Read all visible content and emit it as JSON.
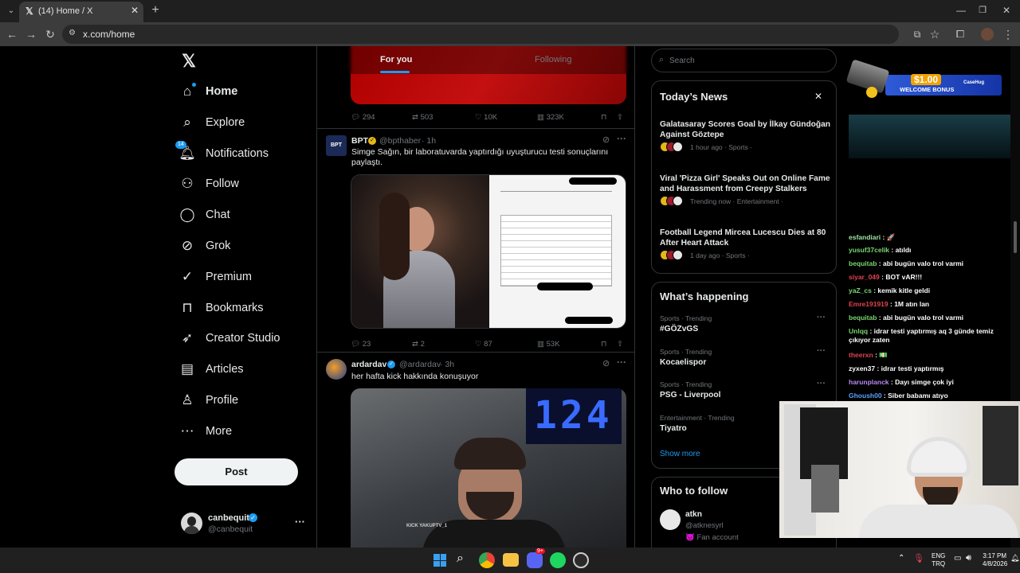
{
  "browser": {
    "tab_title": "(14) Home / X",
    "url": "x.com/home"
  },
  "nav": {
    "items": [
      {
        "label": "Home",
        "icon": "home-icon"
      },
      {
        "label": "Explore",
        "icon": "search-icon"
      },
      {
        "label": "Notifications",
        "icon": "bell-icon",
        "badge": "14"
      },
      {
        "label": "Follow",
        "icon": "add-person-icon"
      },
      {
        "label": "Chat",
        "icon": "chat-icon"
      },
      {
        "label": "Grok",
        "icon": "grok-icon"
      },
      {
        "label": "Premium",
        "icon": "premium-icon"
      },
      {
        "label": "Bookmarks",
        "icon": "bookmark-icon"
      },
      {
        "label": "Creator Studio",
        "icon": "rocket-icon"
      },
      {
        "label": "Articles",
        "icon": "article-icon"
      },
      {
        "label": "Profile",
        "icon": "person-icon"
      },
      {
        "label": "More",
        "icon": "more-circle-icon"
      }
    ],
    "post_label": "Post",
    "account": {
      "name": "canbequit",
      "handle": "@canbequit"
    }
  },
  "feed": {
    "tabs": [
      "For you",
      "Following"
    ],
    "tweet0_stats": {
      "replies": "294",
      "reposts": "503",
      "likes": "10K",
      "views": "323K"
    },
    "tweets": [
      {
        "name": "BPT",
        "avatar_text": "BPT",
        "handle": "@bpthaber",
        "time": "· 1h",
        "text": "Simge Sağın, bir laboratuvarda yaptırdığı uyuşturucu testi sonuçlarını paylaştı.",
        "stats": {
          "replies": "23",
          "reposts": "2",
          "likes": "87",
          "views": "53K"
        }
      },
      {
        "name": "ardardav",
        "handle": "@ardardav",
        "time": "· 3h",
        "text": "her hafta kick hakkında konuşuyor",
        "video_tag": "KICK YAKUPTV_1",
        "video_digits": "124"
      }
    ]
  },
  "right": {
    "search_placeholder": "Search",
    "news": {
      "title": "Today’s News",
      "items": [
        {
          "headline": "Galatasaray Scores Goal by İlkay Gündoğan Against Göztepe",
          "meta": "1 hour ago · Sports ·"
        },
        {
          "headline": "Viral 'Pizza Girl' Speaks Out on Online Fame and Harassment from Creepy Stalkers",
          "meta": "Trending now · Entertainment ·"
        },
        {
          "headline": "Football Legend Mircea Lucescu Dies at 80 After Heart Attack",
          "meta": "1 day ago · Sports ·"
        }
      ]
    },
    "happening": {
      "title": "What’s happening",
      "items": [
        {
          "meta": "Sports · Trending",
          "name": "#GÖZvGS"
        },
        {
          "meta": "Sports · Trending",
          "name": "Kocaelispor"
        },
        {
          "meta": "Sports · Trending",
          "name": "PSG - Liverpool"
        },
        {
          "meta": "Entertainment · Trending",
          "name": "Tiyatro"
        }
      ],
      "show_more": "Show more"
    },
    "follow": {
      "title": "Who to follow",
      "name": "atkn",
      "handle": "@atknesyrl",
      "note": "Fan account"
    }
  },
  "overlay": {
    "ad_amount": "$1.00",
    "ad_text": "WELCOME BONUS",
    "ad_brand": "CaseHug",
    "chat": [
      {
        "user": "esfandiari",
        "msg": " : 🚀",
        "color": "#9de3a3"
      },
      {
        "user": "yusuf37celik",
        "msg": " : atıldı",
        "color": "#7bd66f"
      },
      {
        "user": "bequitab",
        "msg": " : abi bugün valo trol varmi",
        "color": "#7bd66f"
      },
      {
        "user": "siyar_049",
        "msg": " : BOT vAR!!!",
        "color": "#e0424f"
      },
      {
        "user": "yaZ_cs",
        "msg": " : kemik kitle geldi",
        "color": "#7bd66f"
      },
      {
        "user": "Emre191919",
        "msg": " : 1M atın lan",
        "color": "#e0424f"
      },
      {
        "user": "bequitab",
        "msg": " : abi bugün valo trol varmi",
        "color": "#7bd66f"
      },
      {
        "user": "Unlqq",
        "msg": " : idrar testi yaptırmış aq 3 günde temiz çıkıyor zaten",
        "color": "#7bd66f"
      },
      {
        "user": "theerxn",
        "msg": " : 💵",
        "color": "#e0424f"
      },
      {
        "user": "zyxen37",
        "msg": " : idrar testi yaptırmış",
        "color": "#ffffff"
      },
      {
        "user": "harunplanck",
        "msg": " : Dayı simge çok iyi",
        "color": "#b78af0"
      },
      {
        "user": "Ghoush00",
        "msg": " : Siber babamı atıyo",
        "color": "#5aa0ff"
      }
    ]
  },
  "taskbar": {
    "lang1": "ENG",
    "lang2": "TRQ",
    "time": "3:17 PM",
    "date": "4/8/2026",
    "discord_badge": "9+"
  },
  "colors": {
    "accent": "#1d9bf0",
    "verified": "#1d9bf0",
    "gold": "#e2b719"
  }
}
